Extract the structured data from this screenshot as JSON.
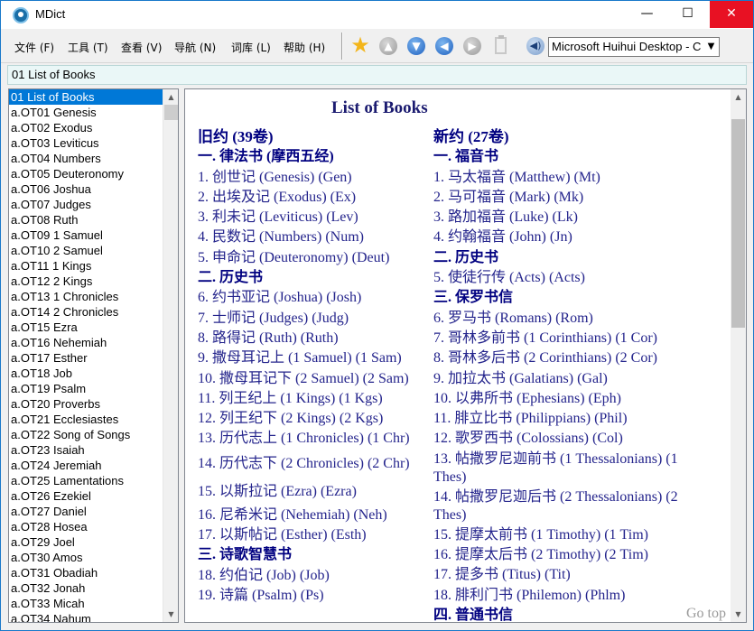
{
  "window": {
    "title": "MDict",
    "minimize_glyph": "—",
    "maximize_glyph": "☐",
    "close_glyph": "✕"
  },
  "menu": [
    {
      "label": "文件 (F)"
    },
    {
      "label": "工具 (T)"
    },
    {
      "label": "查看 (V)"
    },
    {
      "label": "导航 (N)"
    },
    {
      "label": "词库 (L)"
    },
    {
      "label": "帮助 (H)"
    }
  ],
  "toolbar": {
    "favorite_icon": "star-icon",
    "up_icon": "arrow-up-icon",
    "down_icon": "arrow-down-icon",
    "back_icon": "arrow-left-icon",
    "forward_icon": "arrow-right-icon",
    "clipboard_icon": "clipboard-icon",
    "speak_icon": "speaker-icon",
    "voice_selected": "Microsoft Huihui Desktop - C"
  },
  "search": {
    "value": "01 List of Books"
  },
  "word_list": {
    "items": [
      "01 List of Books",
      "a.OT01 Genesis",
      "a.OT02 Exodus",
      "a.OT03 Leviticus",
      "a.OT04 Numbers",
      "a.OT05 Deuteronomy",
      "a.OT06 Joshua",
      "a.OT07 Judges",
      "a.OT08 Ruth",
      "a.OT09 1 Samuel",
      "a.OT10 2 Samuel",
      "a.OT11 1 Kings",
      "a.OT12 2 Kings",
      "a.OT13 1 Chronicles",
      "a.OT14 2 Chronicles",
      "a.OT15 Ezra",
      "a.OT16 Nehemiah",
      "a.OT17 Esther",
      "a.OT18 Job",
      "a.OT19 Psalm",
      "a.OT20 Proverbs",
      "a.OT21 Ecclesiastes",
      "a.OT22 Song of Songs",
      "a.OT23 Isaiah",
      "a.OT24 Jeremiah",
      "a.OT25 Lamentations",
      "a.OT26 Ezekiel",
      "a.OT27 Daniel",
      "a.OT28 Hosea",
      "a.OT29 Joel",
      "a.OT30 Amos",
      "a.OT31 Obadiah",
      "a.OT32 Jonah",
      "a.OT33 Micah",
      "a.OT34 Nahum"
    ],
    "selected_index": 0
  },
  "content": {
    "title": "List of Books",
    "left_column": [
      {
        "text": "旧约 (39卷)",
        "style": "h1"
      },
      {
        "text": "一. 律法书 (摩西五经)",
        "style": "hd"
      },
      {
        "text": "1. 创世记 (Genesis) (Gen)",
        "style": "item"
      },
      {
        "text": "2. 出埃及记 (Exodus) (Ex)",
        "style": "item"
      },
      {
        "text": "3. 利未记 (Leviticus) (Lev)",
        "style": "item"
      },
      {
        "text": "4. 民数记 (Numbers) (Num)",
        "style": "item"
      },
      {
        "text": "5. 申命记 (Deuteronomy) (Deut)",
        "style": "item"
      },
      {
        "text": "二. 历史书",
        "style": "hd"
      },
      {
        "text": "6. 约书亚记 (Joshua) (Josh)",
        "style": "item"
      },
      {
        "text": "7. 士师记 (Judges) (Judg)",
        "style": "item"
      },
      {
        "text": "8. 路得记 (Ruth) (Ruth)",
        "style": "item"
      },
      {
        "text": "9. 撒母耳记上 (1 Samuel) (1 Sam)",
        "style": "item"
      },
      {
        "text": "10. 撒母耳记下 (2 Samuel) (2 Sam)",
        "style": "item"
      },
      {
        "text": "11. 列王纪上 (1 Kings) (1 Kgs)",
        "style": "item"
      },
      {
        "text": "12. 列王纪下 (2 Kings) (2 Kgs)",
        "style": "item"
      },
      {
        "text": "13. 历代志上 (1 Chronicles) (1 Chr)",
        "style": "item"
      },
      {
        "text": "14. 历代志下 (2 Chronicles) (2 Chr)",
        "style": "tall"
      },
      {
        "text": "15. 以斯拉记 (Ezra) (Ezra)",
        "style": "tall"
      },
      {
        "text": "16. 尼希米记 (Nehemiah) (Neh)",
        "style": "item"
      },
      {
        "text": "17. 以斯帖记 (Esther) (Esth)",
        "style": "item"
      },
      {
        "text": "三. 诗歌智慧书",
        "style": "hd"
      },
      {
        "text": "18. 约伯记 (Job) (Job)",
        "style": "item"
      },
      {
        "text": "19. 诗篇 (Psalm) (Ps)",
        "style": "item"
      }
    ],
    "right_column": [
      {
        "text": "新约 (27卷)",
        "style": "h1"
      },
      {
        "text": "一. 福音书",
        "style": "hd"
      },
      {
        "text": "1. 马太福音 (Matthew) (Mt)",
        "style": "item"
      },
      {
        "text": "2. 马可福音 (Mark) (Mk)",
        "style": "item"
      },
      {
        "text": "3. 路加福音 (Luke) (Lk)",
        "style": "item"
      },
      {
        "text": "4. 约翰福音 (John) (Jn)",
        "style": "item"
      },
      {
        "text": "二. 历史书",
        "style": "hd"
      },
      {
        "text": "5. 使徒行传 (Acts) (Acts)",
        "style": "item"
      },
      {
        "text": "三. 保罗书信",
        "style": "hd"
      },
      {
        "text": "6. 罗马书 (Romans) (Rom)",
        "style": "item"
      },
      {
        "text": "7. 哥林多前书 (1 Corinthians) (1 Cor)",
        "style": "item"
      },
      {
        "text": "8. 哥林多后书 (2 Corinthians) (2 Cor)",
        "style": "item"
      },
      {
        "text": "9. 加拉太书 (Galatians) (Gal)",
        "style": "item"
      },
      {
        "text": "10. 以弗所书 (Ephesians) (Eph)",
        "style": "item"
      },
      {
        "text": "11. 腓立比书 (Philippians) (Phil)",
        "style": "item"
      },
      {
        "text": "12. 歌罗西书 (Colossians) (Col)",
        "style": "item"
      },
      {
        "text": "13. 帖撒罗尼迦前书 (1 Thessalonians) (1 Thes)",
        "style": "wrap"
      },
      {
        "text": "14. 帖撒罗尼迦后书 (2 Thessalonians) (2 Thes)",
        "style": "wrap"
      },
      {
        "text": "15. 提摩太前书 (1 Timothy) (1 Tim)",
        "style": "item"
      },
      {
        "text": "16. 提摩太后书 (2 Timothy) (2 Tim)",
        "style": "item"
      },
      {
        "text": "17. 提多书 (Titus) (Tit)",
        "style": "item"
      },
      {
        "text": "18. 腓利门书 (Philemon) (Phlm)",
        "style": "item"
      },
      {
        "text": "四. 普通书信",
        "style": "hd"
      }
    ],
    "go_top_label": "Go top"
  }
}
